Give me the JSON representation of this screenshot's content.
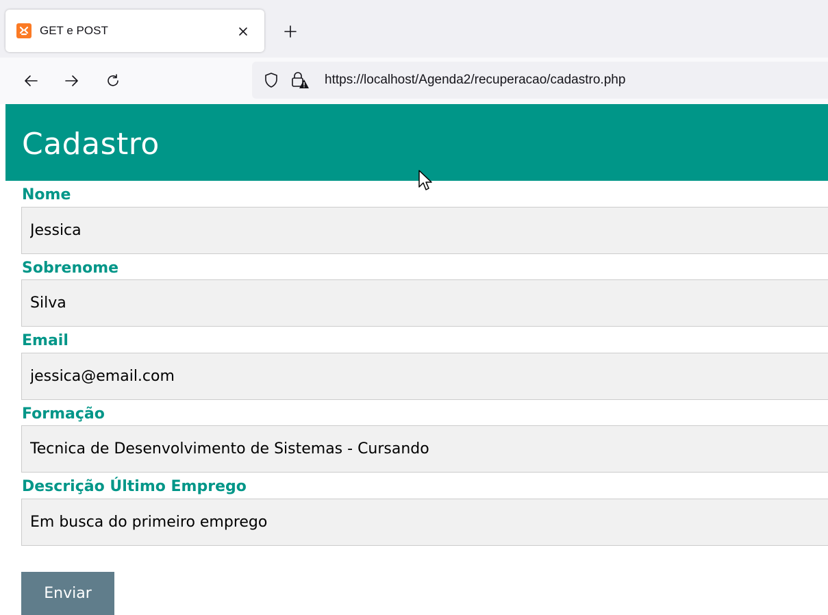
{
  "browser": {
    "tab": {
      "title": "GET e POST",
      "favicon": "xampp-icon"
    },
    "url": "https://localhost/Agenda2/recuperacao/cadastro.php"
  },
  "page": {
    "title": "Cadastro",
    "colors": {
      "header": "#009688",
      "label": "#009688",
      "button": "#607d8b",
      "input_bg": "#f1f1f1"
    },
    "fields": [
      {
        "label": "Nome",
        "value": "Jessica"
      },
      {
        "label": "Sobrenome",
        "value": "Silva"
      },
      {
        "label": "Email",
        "value": "jessica@email.com"
      },
      {
        "label": "Formação",
        "value": "Tecnica de Desenvolvimento de Sistemas - Cursando"
      },
      {
        "label": "Descrição Último Emprego",
        "value": "Em busca do primeiro emprego"
      }
    ],
    "submit_label": "Enviar"
  }
}
